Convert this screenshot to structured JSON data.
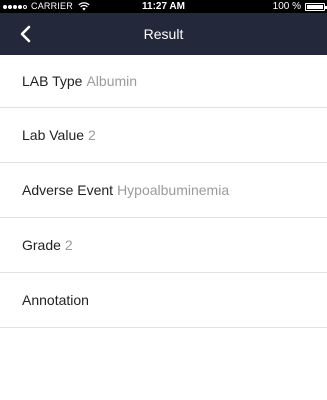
{
  "status_bar": {
    "carrier": "CARRIER",
    "time": "11:27 AM",
    "battery_text": "100 %",
    "battery_level": 1.0
  },
  "nav": {
    "title": "Result",
    "back_icon": "chevron-left-icon"
  },
  "rows": [
    {
      "label": "LAB Type",
      "value": "Albumin"
    },
    {
      "label": "Lab Value",
      "value": "2"
    },
    {
      "label": "Adverse Event",
      "value": "Hypoalbuminemia"
    },
    {
      "label": "Grade",
      "value": "2"
    },
    {
      "label": "Annotation",
      "value": ""
    }
  ],
  "colors": {
    "nav_background": "#24283b",
    "value_text": "#9b9b9b",
    "label_text": "#222222",
    "divider": "#e1e1e1"
  }
}
